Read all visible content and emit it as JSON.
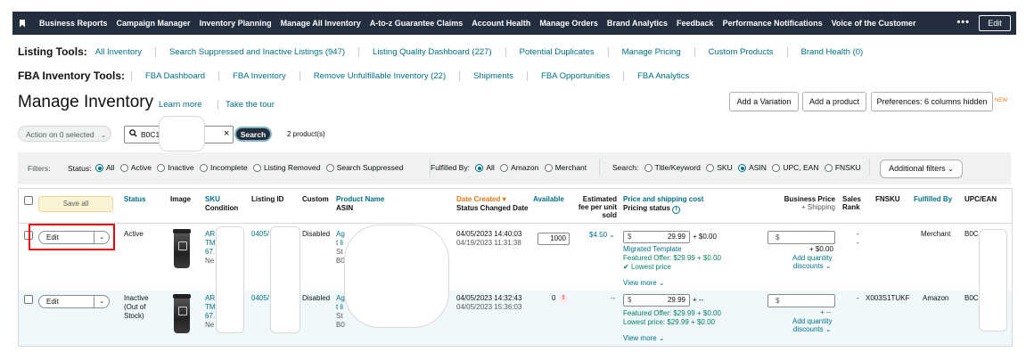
{
  "topnav": {
    "items": [
      "Business Reports",
      "Campaign Manager",
      "Inventory Planning",
      "Manage All Inventory",
      "A-to-z Guarantee Claims",
      "Account Health",
      "Manage Orders",
      "Brand Analytics",
      "Feedback",
      "Performance Notifications",
      "Voice of the Customer"
    ],
    "more_label": "•••",
    "edit_label": "Edit"
  },
  "listing_tools": {
    "label": "Listing Tools:",
    "links": [
      "All Inventory",
      "Search Suppressed and Inactive Listings (947)",
      "Listing Quality Dashboard (227)",
      "Potential Duplicates",
      "Manage Pricing",
      "Custom Products",
      "Brand Health (0)"
    ]
  },
  "fba_tools": {
    "label": "FBA Inventory Tools:",
    "links": [
      "FBA Dashboard",
      "FBA Inventory",
      "Remove Unfulfillable Inventory (22)",
      "Shipments",
      "FBA Opportunities",
      "FBA Analytics"
    ]
  },
  "header": {
    "title": "Manage Inventory",
    "learn_more": "Learn more",
    "take_tour": "Take the tour",
    "add_variation": "Add a Variation",
    "add_product": "Add a product",
    "preferences": "Preferences: 6 columns hidden",
    "new_badge": "NEW"
  },
  "search": {
    "action_label": "Action on 0 selected",
    "value": "B0C1",
    "clear": "×",
    "button": "Search",
    "count": "2 product(s)"
  },
  "filters": {
    "label": "Filters:",
    "status_label": "Status:",
    "status_options": [
      "All",
      "Active",
      "Inactive",
      "Incomplete",
      "Listing Removed",
      "Search Suppressed"
    ],
    "fulfilled_label": "Fulfilled By:",
    "fulfilled_options": [
      "All",
      "Amazon",
      "Merchant"
    ],
    "search_label": "Search:",
    "search_options": [
      "Title/Keyword",
      "SKU",
      "ASIN",
      "UPC, EAN",
      "FNSKU"
    ],
    "additional": "Additional filters"
  },
  "table": {
    "save_all": "Save all",
    "headers": {
      "status": "Status",
      "image": "Image",
      "sku": "SKU",
      "sku_sub": "Condition",
      "listing_id": "Listing ID",
      "custom": "Custom",
      "product_name": "Product Name",
      "product_sub": "ASIN",
      "date_created": "Date Created ▾",
      "date_sub": "Status Changed Date",
      "available": "Available",
      "fee_1": "Estimated",
      "fee_2": "fee per unit",
      "fee_3": "sold",
      "price": "Price and shipping cost",
      "price_sub": "Pricing status",
      "biz_1": "Business Price",
      "biz_2": "+ Shipping",
      "rank_1": "Sales",
      "rank_2": "Rank",
      "fnsku": "FNSKU",
      "fulfilled": "Fulfilled By",
      "upc": "UPC/EAN"
    },
    "rows": [
      {
        "edit": "Edit",
        "status": "Active",
        "sku_lines": [
          "AR",
          "TM",
          "67.",
          "Ne"
        ],
        "listing_id": "0405/",
        "custom": "Disabled",
        "product_lines": [
          "Ag",
          "t li",
          "St",
          "B0"
        ],
        "date_created": "04/05/2023 14:40:03",
        "status_changed": "04/19/2023 11:31:38",
        "available": "1000",
        "fee": "$4.50",
        "price": "29.99",
        "shipping": "+ $0.00",
        "pricing_status": "Migrated Template",
        "featured": "Featured Offer: $29.99 + $0.00",
        "lowest": "Lowest price",
        "view_more": "View more",
        "biz_ship": "+ $0.00",
        "add_qty": "Add quantity",
        "discounts": "discounts",
        "rank": "-",
        "fnsku": "",
        "fulfilled_by": "Merchant",
        "upc": "B0C"
      },
      {
        "edit": "Edit",
        "status_lines": [
          "Inactive",
          "(Out of",
          "Stock)"
        ],
        "sku_lines": [
          "AR",
          "TM",
          "67.",
          "Ne"
        ],
        "listing_id": "0405/",
        "custom": "Disabled",
        "product_lines": [
          "Ag",
          "t li",
          "St",
          "B0"
        ],
        "date_created": "04/05/2023 14:32:43",
        "status_changed": "04/05/2023 15:36:03",
        "available": "0",
        "fee": "--",
        "price": "29.99",
        "shipping": "+ --",
        "featured": "Featured Offer: $29.99 + $0.00",
        "lowest": "Lowest price: $29.99 + $0.00",
        "view_more": "View more",
        "biz_ship": "+ --",
        "add_qty": "Add quantity",
        "discounts": "discounts",
        "rank": "-",
        "fnsku": "X003S1TUKF",
        "fulfilled_by": "Amazon",
        "upc": "B0C"
      }
    ]
  },
  "colors": {
    "nav_bg": "#232f3e",
    "link": "#007185",
    "highlight": "#e0000c",
    "row_selected_bg": "#f0f8fb",
    "warning": "#e47911"
  }
}
